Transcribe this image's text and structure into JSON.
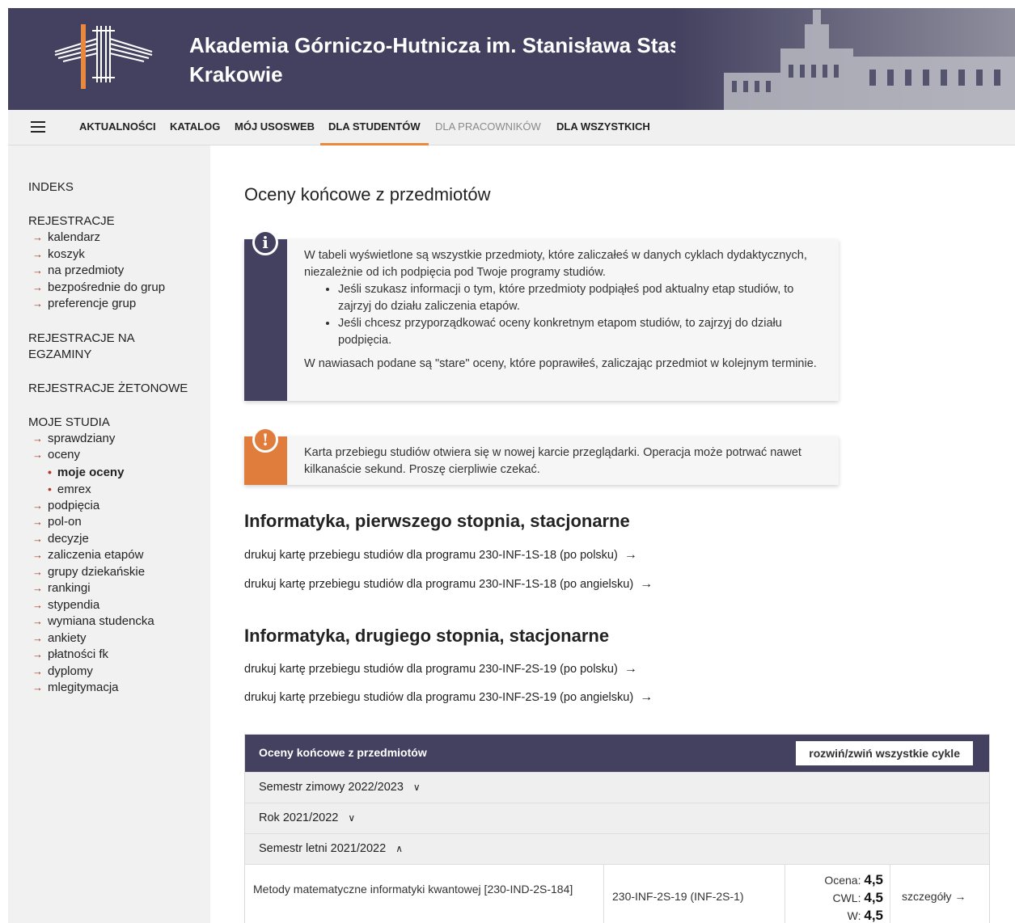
{
  "header": {
    "university": "Akademia Górniczo-Hutnicza im. Stanisława Staszica w Krakowie"
  },
  "nav": {
    "items": [
      {
        "label": "AKTUALNOŚCI"
      },
      {
        "label": "KATALOG"
      },
      {
        "label": "MÓJ USOSWEB"
      },
      {
        "label": "DLA STUDENTÓW"
      },
      {
        "label": "DLA PRACOWNIKÓW"
      },
      {
        "label": "DLA WSZYSTKICH"
      }
    ],
    "active": "DLA STUDENTÓW"
  },
  "sidebar": {
    "indeks": "INDEKS",
    "rejestracje": {
      "label": "REJESTRACJE",
      "items": [
        "kalendarz",
        "koszyk",
        "na przedmioty",
        "bezpośrednie do grup",
        "preferencje grup"
      ]
    },
    "rejestracje_egzaminy": "REJESTRACJE NA EGZAMINY",
    "rejestracje_zetonowe": "REJESTRACJE ŻETONOWE",
    "moje_studia": {
      "label": "MOJE STUDIA",
      "items_before": [
        "sprawdziany",
        "oceny"
      ],
      "oceny_sub": [
        "moje oceny",
        "emrex"
      ],
      "items_after": [
        "podpięcia",
        "pol-on",
        "decyzje",
        "zaliczenia etapów",
        "grupy dziekańskie",
        "rankingi",
        "stypendia",
        "wymiana studencka",
        "ankiety",
        "płatności fk",
        "dyplomy",
        "mlegitymacja"
      ]
    }
  },
  "main": {
    "title": "Oceny końcowe z przedmiotów",
    "info": {
      "p1": "W tabeli wyświetlone są wszystkie przedmioty, które zaliczałeś w danych cyklach dydaktycznych, niezależnie od ich podpięcia pod Twoje programy studiów.",
      "bullet1": "Jeśli szukasz informacji o tym, które przedmioty podpiąłeś pod aktualny etap studiów, to zajrzyj do działu zaliczenia etapów.",
      "bullet2": "Jeśli chcesz przyporządkować oceny konkretnym etapom studiów, to zajrzyj do działu podpięcia.",
      "p2": "W nawiasach podane są \"stare\" oceny, które poprawiłeś, zaliczając przedmiot w kolejnym terminie."
    },
    "warning": "Karta przebiegu studiów otwiera się w nowej karcie przeglądarki. Operacja może potrwać nawet kilkanaście sekund. Proszę cierpliwie czekać.",
    "programs": [
      {
        "title": "Informatyka, pierwszego stopnia, stacjonarne",
        "link_pl": "drukuj kartę przebiegu studiów dla programu 230-INF-1S-18 (po polsku)",
        "link_en": "drukuj kartę przebiegu studiów dla programu 230-INF-1S-18 (po angielsku)"
      },
      {
        "title": "Informatyka, drugiego stopnia, stacjonarne",
        "link_pl": "drukuj kartę przebiegu studiów dla programu 230-INF-2S-19 (po polsku)",
        "link_en": "drukuj kartę przebiegu studiów dla programu 230-INF-2S-19 (po angielsku)"
      }
    ],
    "arrow": "→",
    "grades": {
      "title": "Oceny końcowe z przedmiotów",
      "toggle": "rozwiń/zwiń wszystkie cykle",
      "cycles": [
        {
          "label": "Semestr zimowy 2022/2023",
          "chevron": "∨"
        },
        {
          "label": "Rok 2021/2022",
          "chevron": "∨"
        },
        {
          "label": "Semestr letni 2021/2022",
          "chevron": "∧"
        }
      ],
      "row": {
        "course": "Metody matematyczne informatyki kwantowej [230-IND-2S-184]",
        "program": "230-INF-2S-19 (INF-2S-1)",
        "ocena_label": "Ocena:",
        "ocena": "4,5",
        "cwl_label": "CWL:",
        "cwl": "4,5",
        "w_label": "W:",
        "w": "4,5",
        "details": "szczegóły →"
      }
    }
  },
  "colors": {
    "brand": "#43415f",
    "accent": "#e8893f",
    "warning": "#e07c3c",
    "sidebar_arrow": "#b3382c"
  }
}
